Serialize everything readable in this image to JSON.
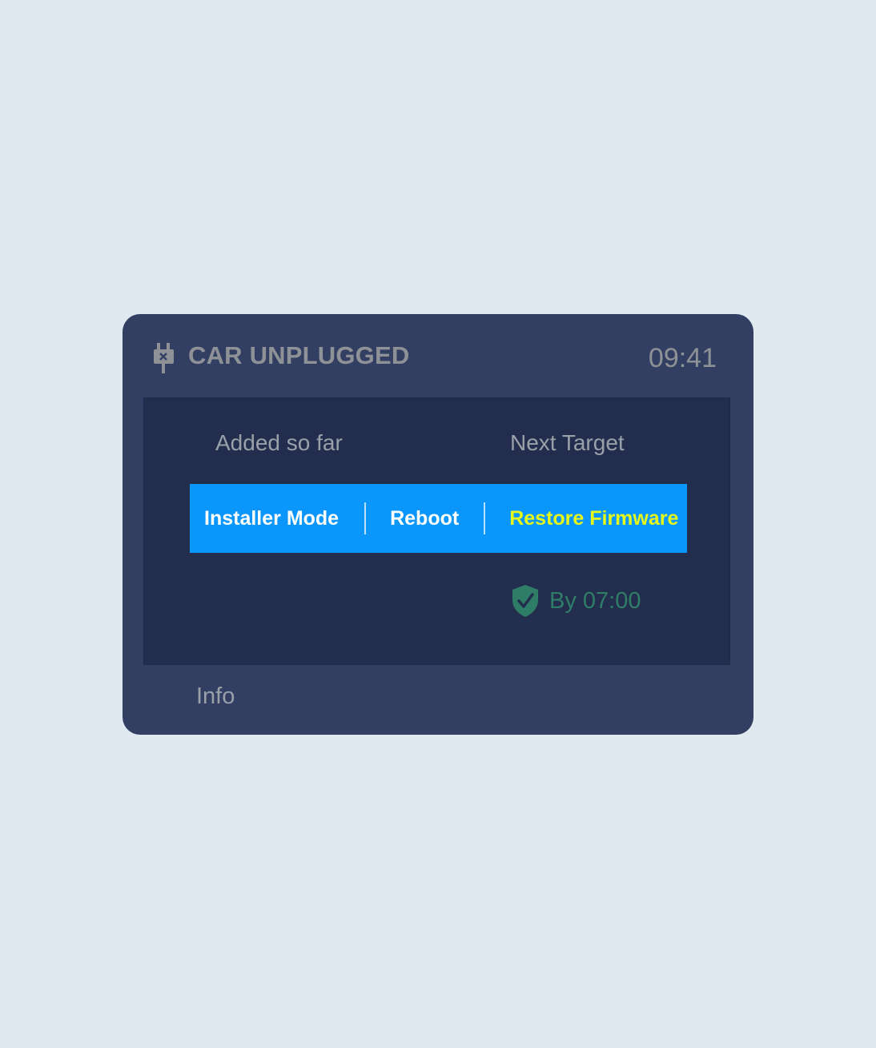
{
  "header": {
    "status_title": "CAR UNPLUGGED",
    "clock": "09:41",
    "status_icon": "plug-icon"
  },
  "stats": {
    "added_label": "Added so far",
    "next_target_label": "Next Target"
  },
  "actions": {
    "installer_mode": "Installer Mode",
    "reboot": "Reboot",
    "restore_firmware": "Restore Firmware"
  },
  "target": {
    "icon": "shield-check-icon",
    "time_text": "By 07:00"
  },
  "footer": {
    "info_label": "Info"
  },
  "colors": {
    "background": "#e0e8f0",
    "device": "#323f63",
    "panel": "#232e4f",
    "action_bar": "#0b96fc",
    "highlight_text": "#e6f71a",
    "target_green": "#2f7d66"
  }
}
